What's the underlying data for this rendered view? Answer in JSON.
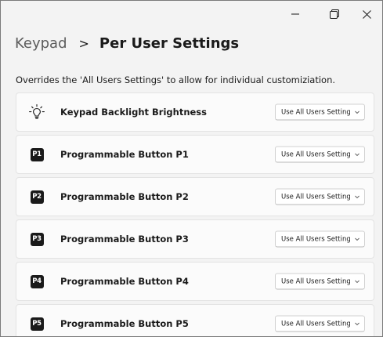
{
  "window": {
    "controls": {
      "minimize_icon": "minimize-icon",
      "restore_icon": "restore-icon",
      "close_icon": "close-icon"
    }
  },
  "breadcrumb": {
    "parent": "Keypad",
    "separator": ">",
    "current": "Per User Settings"
  },
  "description": "Overrides the 'All Users Settings' to allow for individual customiziation.",
  "settings": [
    {
      "icon": "lightbulb-icon",
      "label": "Keypad Backlight Brightness",
      "value": "Use All Users Setting"
    },
    {
      "icon": "p1-badge-icon",
      "badge": "P1",
      "label": "Programmable Button P1",
      "value": "Use All Users Setting"
    },
    {
      "icon": "p2-badge-icon",
      "badge": "P2",
      "label": "Programmable Button P2",
      "value": "Use All Users Setting"
    },
    {
      "icon": "p3-badge-icon",
      "badge": "P3",
      "label": "Programmable Button P3",
      "value": "Use All Users Setting"
    },
    {
      "icon": "p4-badge-icon",
      "badge": "P4",
      "label": "Programmable Button P4",
      "value": "Use All Users Setting"
    },
    {
      "icon": "p5-badge-icon",
      "badge": "P5",
      "label": "Programmable Button P5",
      "value": "Use All Users Setting"
    }
  ],
  "colors": {
    "window_background": "#f3f3f3",
    "card_background": "#fbfbfb",
    "text": "#1a1a1a",
    "badge_background": "#1a1a1a"
  }
}
